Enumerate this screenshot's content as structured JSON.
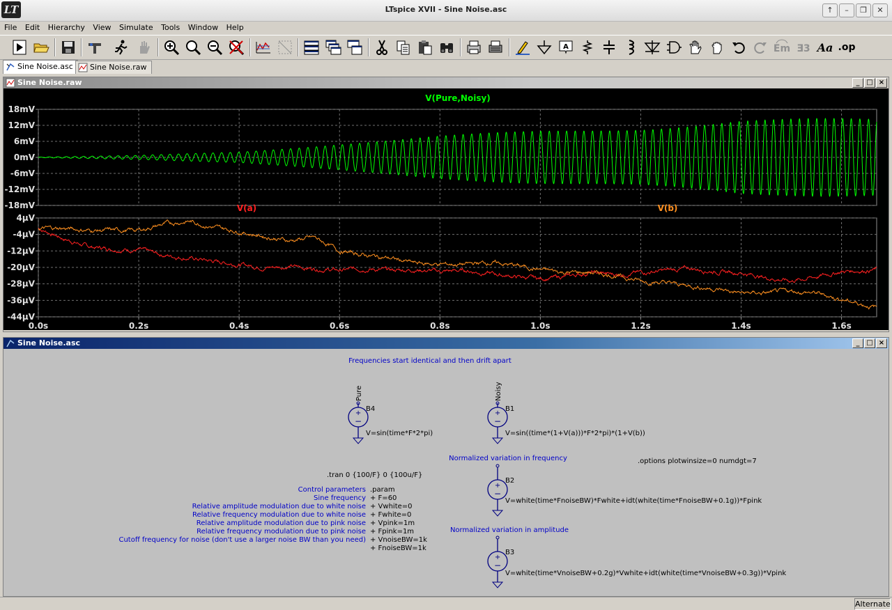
{
  "window": {
    "title": "LTspice XVII - Sine Noise.asc",
    "controls": [
      "↑",
      "–",
      "❐",
      "✕"
    ]
  },
  "menu": [
    "File",
    "Edit",
    "Hierarchy",
    "View",
    "Simulate",
    "Tools",
    "Window",
    "Help"
  ],
  "toolbar": [
    "run-icon",
    "open-folder-icon",
    "save-icon",
    "control-panel-icon",
    "run-man-icon",
    "halt-hand-icon",
    "zoom-in-icon",
    "zoom-area-icon",
    "zoom-out-icon",
    "zoom-cancel-icon",
    "autorange-icon",
    "view-fft-icon",
    "tile-horizontal-icon",
    "cascade-icon",
    "tile-vertical-icon",
    "cut-icon",
    "copy-icon",
    "paste-icon",
    "find-icon",
    "print-preview-icon",
    "print-icon",
    "draw-wire-icon",
    "ground-icon",
    "label-net-icon",
    "resistor-icon",
    "capacitor-icon",
    "inductor-icon",
    "diode-icon",
    "component-icon",
    "move-hand-icon",
    "drag-hand-icon",
    "undo-icon",
    "redo-icon",
    "rotate-icon",
    "mirror-icon",
    "text-icon",
    "spice-directive-icon"
  ],
  "toolbar_text": {
    "text_tool": "Aa",
    "spice_directive": ".op"
  },
  "tabs": [
    {
      "label": "Sine Noise.asc",
      "icon": "schematic-icon",
      "active": true
    },
    {
      "label": "Sine Noise.raw",
      "icon": "waveform-icon",
      "active": false
    }
  ],
  "waveform_window": {
    "title": "Sine Noise.raw"
  },
  "schematic_window": {
    "title": "Sine Noise.asc"
  },
  "chart_data": [
    {
      "type": "line",
      "series": [
        {
          "name": "V(Pure,Noisy)",
          "color": "#00ff00",
          "amplitude_envelope": {
            "x": [
              0.0,
              0.2,
              0.4,
              0.6,
              0.8,
              1.0,
              1.2,
              1.4,
              1.67
            ],
            "y": [
              0.0001,
              0.0007,
              0.002,
              0.005,
              0.0075,
              0.0095,
              0.011,
              0.0135,
              0.0135
            ]
          },
          "frequency_hz": 60
        }
      ],
      "ylim": [
        -0.018,
        0.018
      ],
      "yticks": [
        "18mV",
        "12mV",
        "6mV",
        "0mV",
        "-6mV",
        "-12mV",
        "-18mV"
      ],
      "xlim": [
        0,
        1.67
      ],
      "grid": true,
      "background": "#000000"
    },
    {
      "type": "line",
      "series": [
        {
          "name": "V(a)",
          "color": "#ff2020",
          "x": [
            0.0,
            0.05,
            0.1,
            0.15,
            0.2,
            0.25,
            0.3,
            0.35,
            0.4,
            0.45,
            0.5,
            0.55,
            0.6,
            0.65,
            0.7,
            0.75,
            0.8,
            0.85,
            0.9,
            0.95,
            1.0,
            1.05,
            1.1,
            1.15,
            1.2,
            1.25,
            1.3,
            1.35,
            1.4,
            1.45,
            1.5,
            1.55,
            1.6,
            1.67
          ],
          "y": [
            -1e-06,
            -6e-06,
            -1e-05,
            -1.1e-05,
            -1.15e-05,
            -1.4e-05,
            -1.55e-05,
            -1.7e-05,
            -1.85e-05,
            -2e-05,
            -1.95e-05,
            -2.05e-05,
            -2.15e-05,
            -2.05e-05,
            -2.15e-05,
            -2.1e-05,
            -2.2e-05,
            -2.15e-05,
            -2.3e-05,
            -2.45e-05,
            -2.55e-05,
            -2.45e-05,
            -2.25e-05,
            -2.35e-05,
            -2.25e-05,
            -2.15e-05,
            -2.05e-05,
            -2.2e-05,
            -2.25e-05,
            -2.5e-05,
            -2.65e-05,
            -2.45e-05,
            -2.2e-05,
            -2.1e-05
          ]
        },
        {
          "name": "V(b)",
          "color": "#ff9020",
          "x": [
            0.0,
            0.05,
            0.1,
            0.15,
            0.2,
            0.25,
            0.3,
            0.35,
            0.4,
            0.45,
            0.5,
            0.55,
            0.6,
            0.65,
            0.7,
            0.75,
            0.8,
            0.85,
            0.9,
            0.95,
            1.0,
            1.05,
            1.1,
            1.15,
            1.2,
            1.25,
            1.3,
            1.35,
            1.4,
            1.45,
            1.5,
            1.55,
            1.6,
            1.67
          ],
          "y": [
            -1e-06,
            -1e-06,
            -2e-06,
            -2e-06,
            -2e-06,
            1e-06,
            2.5e-06,
            -5e-07,
            -2.5e-06,
            -5e-06,
            -7e-06,
            -5.5e-06,
            -1.2e-05,
            -1.4e-05,
            -1.55e-05,
            -1.8e-05,
            -1.85e-05,
            -1.85e-05,
            -1.75e-05,
            -1.9e-05,
            -2.1e-05,
            -2.25e-05,
            -2.25e-05,
            -2.4e-05,
            -2.65e-05,
            -2.75e-05,
            -2.9e-05,
            -3.05e-05,
            -3.25e-05,
            -3.25e-05,
            -3.15e-05,
            -3.25e-05,
            -3.55e-05,
            -3.95e-05
          ]
        }
      ],
      "ylim": [
        -4.4e-05,
        4e-06
      ],
      "yticks": [
        "4µV",
        "-4µV",
        "-12µV",
        "-20µV",
        "-28µV",
        "-36µV",
        "-44µV"
      ],
      "xlim": [
        0,
        1.67
      ],
      "xticks": [
        "0.0s",
        "0.2s",
        "0.4s",
        "0.6s",
        "0.8s",
        "1.0s",
        "1.2s",
        "1.4s",
        "1.6s"
      ],
      "grid": true,
      "background": "#000000"
    }
  ],
  "schematic": {
    "heading": "Frequencies start identical and then drift apart",
    "net_pure": "Pure",
    "net_noisy": "Noisy",
    "b4_name": "B4",
    "b4_value": "V=sin(time*F*2*pi)",
    "b1_name": "B1",
    "b1_value": "V=sin((time*(1+V(a)))*F*2*pi)*(1+V(b))",
    "freq_label": "Normalized variation in frequency",
    "b2_name": "B2",
    "b2_value": "V=white(time*FnoiseBW)*Fwhite+idt(white(time*FnoiseBW+0.1g))*Fpink",
    "amp_label": "Normalized variation in amplitude",
    "b3_name": "B3",
    "b3_value": "V=white(time*VnoiseBW+0.2g)*Vwhite+idt(white(time*VnoiseBW+0.3g))*Vpink",
    "options": ".options plotwinsize=0 numdgt=7",
    "tran": ".tran 0 {100/F} 0 {100u/F}",
    "comments": [
      "Control parameters",
      "Sine frequency",
      "Relative amplitude modulation due to white noise",
      "Relative frequency modulation due to white noise",
      "Relative amplitude modulation due to pink noise",
      "Relative frequency modulation due to pink noise",
      "Cutoff frequency for noise (don't use a larger noise BW than you need)"
    ],
    "params": [
      ".param",
      "+ F=60",
      "+ Vwhite=0",
      "+ Fwhite=0",
      "+ Vpink=1m",
      "+ Fpink=1m",
      "+ VnoiseBW=1k",
      "+ FnoiseBW=1k"
    ]
  },
  "status": {
    "right": "Alternate"
  }
}
